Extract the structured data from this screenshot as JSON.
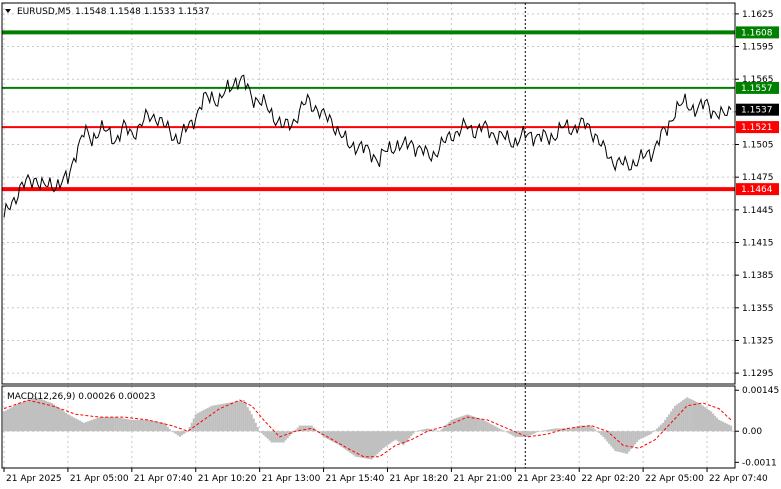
{
  "title": {
    "symbol": "EURUSD,M5",
    "ohlc": "1.1548 1.1548 1.1533 1.1537"
  },
  "macd": {
    "label": "MACD(12,26,9) 0.00026 0.00023",
    "ylim": [
      -0.0013,
      0.0016
    ],
    "ticks": [
      "0.00145",
      "0.00",
      "-0.0011"
    ],
    "tick_values": [
      0.00145,
      0.0,
      -0.0011
    ],
    "histogram_color": "#c0c0c0",
    "signal_color": "#ff0000"
  },
  "colors": {
    "price_line": "#000000",
    "resistance": "#008000",
    "support": "#ff0000",
    "grid": "#c8c8c8",
    "current_tag": "#000000"
  },
  "chart_data": {
    "type": "line",
    "title": "EURUSD,M5 1.1548 1.1548 1.1533 1.1537",
    "ylim": [
      1.1285,
      1.1635
    ],
    "yticks": [
      "1.1625",
      "1.1595",
      "1.1565",
      "1.1535",
      "1.1505",
      "1.1475",
      "1.1445",
      "1.1415",
      "1.1385",
      "1.1355",
      "1.1325",
      "1.1295"
    ],
    "ytick_values": [
      1.1625,
      1.1595,
      1.1565,
      1.1535,
      1.1505,
      1.1475,
      1.1445,
      1.1415,
      1.1385,
      1.1355,
      1.1325,
      1.1295
    ],
    "xticks": [
      "21 Apr 2025",
      "21 Apr 05:00",
      "21 Apr 07:40",
      "21 Apr 10:20",
      "21 Apr 13:00",
      "21 Apr 15:40",
      "21 Apr 18:20",
      "21 Apr 21:00",
      "21 Apr 23:40",
      "22 Apr 02:20",
      "22 Apr 05:00",
      "22 Apr 07:40"
    ],
    "xtick_index": [
      0,
      32,
      64,
      96,
      128,
      160,
      192,
      224,
      256,
      288,
      320,
      352
    ],
    "grid": true,
    "vertical_marker_index": 261,
    "levels": [
      {
        "value": 1.1608,
        "label": "1.1608",
        "kind": "resistance",
        "thick": true
      },
      {
        "value": 1.1557,
        "label": "1.1557",
        "kind": "resistance",
        "thick": false
      },
      {
        "value": 1.1521,
        "label": "1.1521",
        "kind": "support",
        "thick": false
      },
      {
        "value": 1.1464,
        "label": "1.1464",
        "kind": "support",
        "thick": true
      }
    ],
    "current": {
      "value": 1.1537,
      "label": "1.1537"
    },
    "price_anchors": [
      [
        0,
        1.1438
      ],
      [
        4,
        1.1452
      ],
      [
        8,
        1.1465
      ],
      [
        12,
        1.147
      ],
      [
        16,
        1.1475
      ],
      [
        20,
        1.1465
      ],
      [
        24,
        1.1468
      ],
      [
        28,
        1.147
      ],
      [
        32,
        1.1472
      ],
      [
        36,
        1.15
      ],
      [
        40,
        1.1515
      ],
      [
        44,
        1.151
      ],
      [
        48,
        1.152
      ],
      [
        52,
        1.1515
      ],
      [
        56,
        1.151
      ],
      [
        60,
        1.152
      ],
      [
        64,
        1.1515
      ],
      [
        68,
        1.1522
      ],
      [
        72,
        1.153
      ],
      [
        76,
        1.1532
      ],
      [
        80,
        1.1522
      ],
      [
        84,
        1.1515
      ],
      [
        88,
        1.151
      ],
      [
        92,
        1.152
      ],
      [
        96,
        1.1532
      ],
      [
        100,
        1.1545
      ],
      [
        104,
        1.155
      ],
      [
        108,
        1.1545
      ],
      [
        112,
        1.1555
      ],
      [
        116,
        1.1565
      ],
      [
        120,
        1.1562
      ],
      [
        124,
        1.155
      ],
      [
        128,
        1.1545
      ],
      [
        132,
        1.1538
      ],
      [
        136,
        1.153
      ],
      [
        140,
        1.152
      ],
      [
        144,
        1.1525
      ],
      [
        148,
        1.1535
      ],
      [
        152,
        1.1545
      ],
      [
        156,
        1.154
      ],
      [
        160,
        1.153
      ],
      [
        164,
        1.1528
      ],
      [
        168,
        1.1515
      ],
      [
        172,
        1.1505
      ],
      [
        176,
        1.1505
      ],
      [
        180,
        1.15
      ],
      [
        184,
        1.1498
      ],
      [
        188,
        1.149
      ],
      [
        192,
        1.15
      ],
      [
        196,
        1.1505
      ],
      [
        200,
        1.1502
      ],
      [
        204,
        1.1508
      ],
      [
        208,
        1.15
      ],
      [
        212,
        1.1495
      ],
      [
        216,
        1.1498
      ],
      [
        220,
        1.1505
      ],
      [
        224,
        1.1515
      ],
      [
        228,
        1.1517
      ],
      [
        232,
        1.1522
      ],
      [
        236,
        1.1518
      ],
      [
        240,
        1.152
      ],
      [
        244,
        1.1517
      ],
      [
        248,
        1.1512
      ],
      [
        252,
        1.151
      ],
      [
        256,
        1.1508
      ],
      [
        260,
        1.1512
      ],
      [
        264,
        1.1515
      ],
      [
        268,
        1.1512
      ],
      [
        272,
        1.151
      ],
      [
        276,
        1.1515
      ],
      [
        280,
        1.152
      ],
      [
        284,
        1.152
      ],
      [
        288,
        1.1523
      ],
      [
        292,
        1.1522
      ],
      [
        296,
        1.1515
      ],
      [
        300,
        1.15
      ],
      [
        304,
        1.1492
      ],
      [
        308,
        1.1488
      ],
      [
        312,
        1.1485
      ],
      [
        316,
        1.149
      ],
      [
        320,
        1.1492
      ],
      [
        324,
        1.1498
      ],
      [
        328,
        1.151
      ],
      [
        332,
        1.1518
      ],
      [
        336,
        1.1538
      ],
      [
        340,
        1.1542
      ],
      [
        344,
        1.154
      ],
      [
        348,
        1.1538
      ],
      [
        352,
        1.1542
      ],
      [
        356,
        1.1535
      ],
      [
        360,
        1.153
      ],
      [
        364,
        1.1537
      ]
    ],
    "macd_anchors": [
      [
        0,
        0.0007
      ],
      [
        8,
        0.001
      ],
      [
        16,
        0.0012
      ],
      [
        24,
        0.001
      ],
      [
        32,
        0.0006
      ],
      [
        40,
        0.0003
      ],
      [
        48,
        0.0005
      ],
      [
        56,
        0.0005
      ],
      [
        64,
        0.0004
      ],
      [
        72,
        0.0004
      ],
      [
        80,
        0.0003
      ],
      [
        84,
        0.0
      ],
      [
        88,
        -0.0002
      ],
      [
        92,
        0.0
      ],
      [
        96,
        0.0006
      ],
      [
        104,
        0.0009
      ],
      [
        112,
        0.001
      ],
      [
        120,
        0.0011
      ],
      [
        124,
        0.0006
      ],
      [
        128,
        0.0
      ],
      [
        134,
        -0.0004
      ],
      [
        140,
        -0.0004
      ],
      [
        148,
        0.0002
      ],
      [
        154,
        0.0002
      ],
      [
        160,
        -0.0002
      ],
      [
        168,
        -0.0005
      ],
      [
        176,
        -0.0009
      ],
      [
        184,
        -0.001
      ],
      [
        190,
        -0.0006
      ],
      [
        196,
        -0.0003
      ],
      [
        200,
        -0.0005
      ],
      [
        206,
        0.0
      ],
      [
        212,
        0.0001
      ],
      [
        218,
        0.0
      ],
      [
        224,
        0.0004
      ],
      [
        232,
        0.0006
      ],
      [
        240,
        0.0004
      ],
      [
        248,
        0.0001
      ],
      [
        256,
        -0.0002
      ],
      [
        262,
        -0.0002
      ],
      [
        268,
        0.0
      ],
      [
        276,
        0.0001
      ],
      [
        284,
        0.0001
      ],
      [
        288,
        0.0002
      ],
      [
        294,
        0.0002
      ],
      [
        300,
        -0.0002
      ],
      [
        306,
        -0.0007
      ],
      [
        312,
        -0.0008
      ],
      [
        318,
        -0.0003
      ],
      [
        324,
        -0.0001
      ],
      [
        330,
        0.0003
      ],
      [
        336,
        0.0009
      ],
      [
        342,
        0.0012
      ],
      [
        348,
        0.001
      ],
      [
        354,
        0.0007
      ],
      [
        358,
        0.0004
      ],
      [
        364,
        0.0002
      ]
    ],
    "signal_anchors": [
      [
        0,
        0.0008
      ],
      [
        12,
        0.0011
      ],
      [
        24,
        0.0009
      ],
      [
        36,
        0.0006
      ],
      [
        48,
        0.0005
      ],
      [
        60,
        0.0005
      ],
      [
        72,
        0.0004
      ],
      [
        84,
        0.0002
      ],
      [
        92,
        0.0
      ],
      [
        100,
        0.0004
      ],
      [
        108,
        0.0008
      ],
      [
        118,
        0.0011
      ],
      [
        124,
        0.0009
      ],
      [
        130,
        0.0004
      ],
      [
        138,
        -0.0002
      ],
      [
        146,
        0.0
      ],
      [
        154,
        0.0001
      ],
      [
        162,
        -0.0002
      ],
      [
        172,
        -0.0006
      ],
      [
        180,
        -0.0009
      ],
      [
        188,
        -0.0009
      ],
      [
        196,
        -0.0005
      ],
      [
        204,
        -0.0003
      ],
      [
        212,
        0.0
      ],
      [
        222,
        0.0002
      ],
      [
        232,
        0.0005
      ],
      [
        242,
        0.0004
      ],
      [
        252,
        0.0001
      ],
      [
        262,
        -0.0002
      ],
      [
        272,
        -0.0001
      ],
      [
        282,
        0.0001
      ],
      [
        294,
        0.0002
      ],
      [
        302,
        0.0
      ],
      [
        310,
        -0.0005
      ],
      [
        318,
        -0.0006
      ],
      [
        326,
        -0.0003
      ],
      [
        334,
        0.0003
      ],
      [
        342,
        0.0009
      ],
      [
        350,
        0.001
      ],
      [
        358,
        0.0008
      ],
      [
        364,
        0.0004
      ]
    ]
  }
}
